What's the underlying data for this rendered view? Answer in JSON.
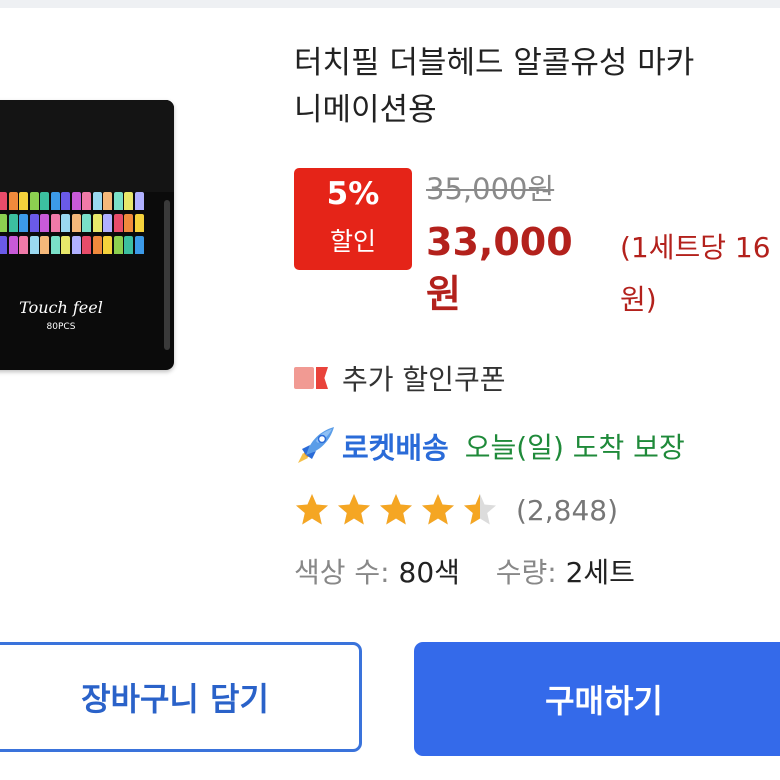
{
  "product": {
    "title_line1": "터치필 더블헤드 알콜유성 마카",
    "title_line2": "니메이션용",
    "image": {
      "brand": "Touch feel",
      "pcs": "80PCS"
    }
  },
  "pricing": {
    "discount_percent": "5%",
    "discount_label": "할인",
    "original_price": "35,000원",
    "sale_price_amount": "33,000",
    "sale_price_unit": "원",
    "unit_price_line1": "(1세트당 16",
    "unit_price_line2": "원)",
    "accent_color": "#e52418"
  },
  "coupon": {
    "icon": "coupon-icon",
    "label": "추가 할인쿠폰"
  },
  "delivery": {
    "icon": "rocket-icon",
    "badge": "로켓배송",
    "promise": "오늘(일) 도착 보장",
    "badge_color": "#2a6bd8",
    "promise_color": "#1f8a3a"
  },
  "rating": {
    "stars": 4.5,
    "max_stars": 5,
    "review_count": "(2,848)",
    "star_color": "#f5a623"
  },
  "options": {
    "color_label": "색상 수:",
    "color_value": "80색",
    "quantity_label": "수량:",
    "quantity_value": "2세트"
  },
  "actions": {
    "cart_label": "장바구니 담기",
    "buy_label": "구매하기",
    "primary_color": "#346aea"
  }
}
